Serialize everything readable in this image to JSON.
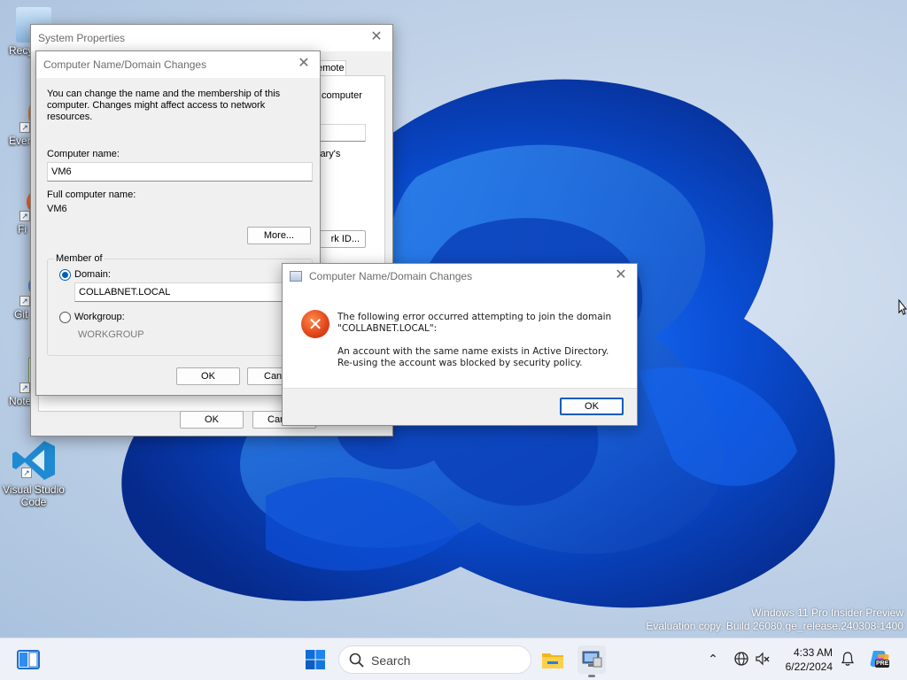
{
  "desktop": {
    "icons": [
      {
        "label": "Recy"
      },
      {
        "label": "Ever"
      },
      {
        "label": "Fi"
      },
      {
        "label": "Git"
      },
      {
        "label": "Note"
      },
      {
        "label": "Visual Studio Code"
      }
    ],
    "watermark_line1": "Windows 11 Pro Insider Preview",
    "watermark_line2": "Evaluation copy. Build 26080.ge_release.240308-1400"
  },
  "system_properties": {
    "title": "System Properties",
    "tab_fragment": "emote",
    "text_fragment1": "computer",
    "text_fragment2": "lary's",
    "network_id_fragment": "rk ID...",
    "ok": "OK",
    "cancel_fragment": "Can"
  },
  "name_dialog": {
    "title": "Computer Name/Domain Changes",
    "intro": "You can change the name and the membership of this computer. Changes might affect access to network resources.",
    "computer_name_label": "Computer name:",
    "computer_name_value": "VM6",
    "full_name_label": "Full computer name:",
    "full_name_value": "VM6",
    "more_button": "More...",
    "member_of_label": "Member of",
    "domain_label": "Domain:",
    "domain_value": "COLLABNET.LOCAL",
    "workgroup_label": "Workgroup:",
    "workgroup_value": "WORKGROUP",
    "ok": "OK",
    "cancel_fragment": "Canc"
  },
  "error_dialog": {
    "title": "Computer Name/Domain Changes",
    "line1": "The following error occurred attempting to join the domain",
    "line2": "\"COLLABNET.LOCAL\":",
    "line3": "An account with the same name exists in Active Directory.",
    "line4": "Re-using the account was blocked by security policy.",
    "ok": "OK"
  },
  "taskbar": {
    "search_placeholder": "Search",
    "time": "4:33 AM",
    "date": "6/22/2024",
    "copilot_badge": "PRE"
  }
}
